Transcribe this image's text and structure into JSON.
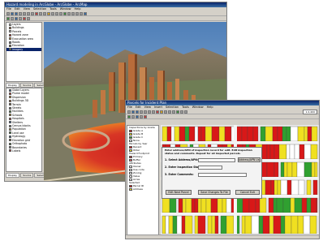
{
  "gis_window": {
    "title": "Hazard modeling in ArcGlobe - ArcGlobe - ArcMap",
    "menu": [
      "File",
      "Edit",
      "View",
      "Selection",
      "Tools",
      "Window",
      "Help"
    ],
    "toc_items": [
      {
        "label": "Layers",
        "color": "#ffffff",
        "selected": false
      },
      {
        "label": "Buildings",
        "color": "#c8783c",
        "selected": false
      },
      {
        "label": "Parcels",
        "color": "#e8e8e8",
        "selected": false
      },
      {
        "label": "Hazard zone",
        "color": "#e03020",
        "selected": false
      },
      {
        "label": "Evacuation area",
        "color": "#f0a020",
        "selected": false
      },
      {
        "label": "Roads",
        "color": "#888888",
        "selected": false
      },
      {
        "label": "Elevation",
        "color": "#8a6a40",
        "selected": false
      },
      {
        "label": "Imagery",
        "color": "#5e8a4a",
        "selected": true
      }
    ],
    "tabs": [
      "Display",
      "Source",
      "Selection"
    ],
    "catalog_items": [
      {
        "label": "Globe Layers",
        "color": "#3a6aa0"
      },
      {
        "label": "Plume model",
        "color": "#e03020"
      },
      {
        "label": "Dispersion",
        "color": "#f0a020"
      },
      {
        "label": "Buildings 3D",
        "color": "#c8783c"
      },
      {
        "label": "Terrain",
        "color": "#8a6a40"
      },
      {
        "label": "Streets",
        "color": "#888888"
      },
      {
        "label": "Facilities",
        "color": "#3e8e3e"
      },
      {
        "label": "Schools",
        "color": "#d0a020"
      },
      {
        "label": "Hospitals",
        "color": "#c04040"
      },
      {
        "label": "Shelters",
        "color": "#3a6aa0"
      },
      {
        "label": "Census blocks",
        "color": "#9a9a9a"
      },
      {
        "label": "Population",
        "color": "#d0a020"
      },
      {
        "label": "Land use",
        "color": "#3e8e3e"
      },
      {
        "label": "Hydrology",
        "color": "#3a6aa0"
      },
      {
        "label": "Elevation grid",
        "color": "#8a6a40"
      },
      {
        "label": "Orthophoto",
        "color": "#5e8a4a"
      },
      {
        "label": "Boundaries",
        "color": "#9a9a9a"
      },
      {
        "label": "Labels",
        "color": "#c04040"
      }
    ],
    "bottom_tabs": [
      "Display",
      "Source",
      "Selection"
    ],
    "status": ""
  },
  "parcel_window": {
    "title": "Parcels for Incident Plan",
    "menu": [
      "File",
      "Edit",
      "View",
      "Insert",
      "Selection",
      "Tools",
      "Window",
      "Help"
    ],
    "legend_sections": [
      {
        "heading": "Inspections by Grade",
        "entries": [
          {
            "label": "Grade A",
            "color": "#d81818"
          },
          {
            "label": "Grade B",
            "color": "#f0e020"
          },
          {
            "label": "Grade C",
            "color": "#30a030"
          },
          {
            "label": "None",
            "color": "#ffffff"
          }
        ]
      },
      {
        "heading": "Parcels by Year",
        "entries": [
          {
            "label": "Recent",
            "color": "#d81818"
          },
          {
            "label": "Older",
            "color": "#f0e020"
          }
        ]
      },
      {
        "heading": "Hazard Footprint",
        "entries": [
          {
            "label": "Primary",
            "color": "#b03030"
          },
          {
            "label": "Buffer",
            "color": "#e06060"
          }
        ]
      },
      {
        "heading": "Attributes",
        "entries": [
          {
            "label": "Owner",
            "color": "#ffffff"
          },
          {
            "label": "Use code",
            "color": "#ffffff"
          },
          {
            "label": "Zoning",
            "color": "#ffffff"
          },
          {
            "label": "Value",
            "color": "#ffffff"
          },
          {
            "label": "Acres",
            "color": "#ffffff"
          }
        ]
      },
      {
        "heading": "Selected",
        "entries": [
          {
            "label": "Parcel ID",
            "color": "#d81818"
          },
          {
            "label": "Address",
            "color": "#f0e020"
          }
        ]
      }
    ],
    "dialog": {
      "instructions": "Enter address/APN of inspection record for edit. Edit inspection status and comments. Repeat for all inspected parcels.",
      "field1_label": "1. Select Address/APN:",
      "field1_button": "Address/APN List",
      "field2_label": "2. Enter Inspection Status:",
      "field3_label": "3. Enter Comments:",
      "buttons": [
        "Edit Next Parcel",
        "Save Changes To File",
        "Cancel Exit"
      ]
    },
    "scale": "1:2,400",
    "status": ""
  },
  "colors": {
    "window_chrome": "#d4d0c8",
    "titlebar": "#0a246a",
    "sky": "#6e9ec8",
    "hazard_red": "#e03020",
    "hazard_orange": "#f0a020",
    "parcel_red": "#d81818",
    "parcel_yellow": "#f0e020",
    "parcel_green": "#30a030"
  }
}
